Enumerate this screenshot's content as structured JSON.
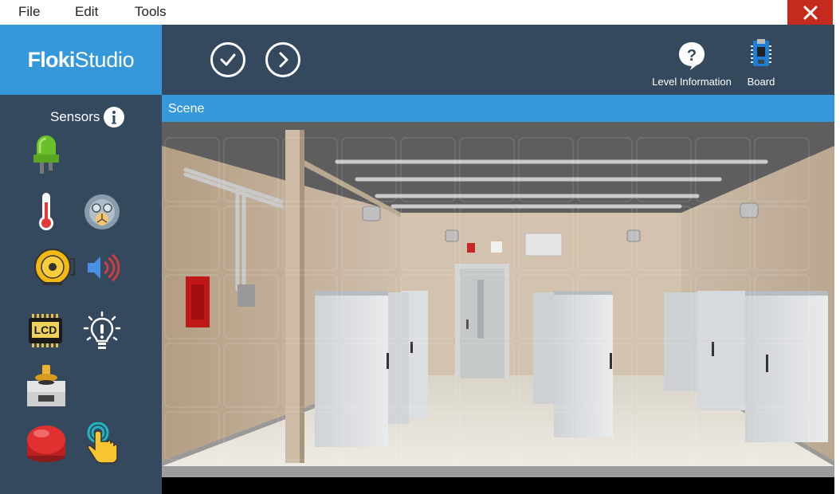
{
  "menubar": {
    "items": [
      "File",
      "Edit",
      "Tools"
    ]
  },
  "window": {
    "close_icon": "close-icon"
  },
  "logo": {
    "part1": "Floki",
    "part2": "Studio"
  },
  "toolbar": {
    "check_icon": "check-icon",
    "next_icon": "chevron-right-icon",
    "level_info_label": "Level Information",
    "board_label": "Board"
  },
  "sidebar": {
    "title": "Sensors",
    "info_icon": "info-icon",
    "sensors": [
      {
        "name": "led-icon"
      },
      {
        "name": "thermometer-icon"
      },
      {
        "name": "gas-sensor-icon"
      },
      {
        "name": "bell-icon"
      },
      {
        "name": "speaker-icon"
      },
      {
        "name": "lcd-icon"
      },
      {
        "name": "lightbulb-icon"
      },
      {
        "name": "joystick-icon"
      },
      {
        "name": "red-button-icon"
      },
      {
        "name": "touch-icon"
      }
    ],
    "lcd_text": "LCD"
  },
  "scene": {
    "title": "Scene"
  },
  "colors": {
    "primary": "#3498db",
    "dark": "#34495e",
    "close": "#c42b1c"
  }
}
